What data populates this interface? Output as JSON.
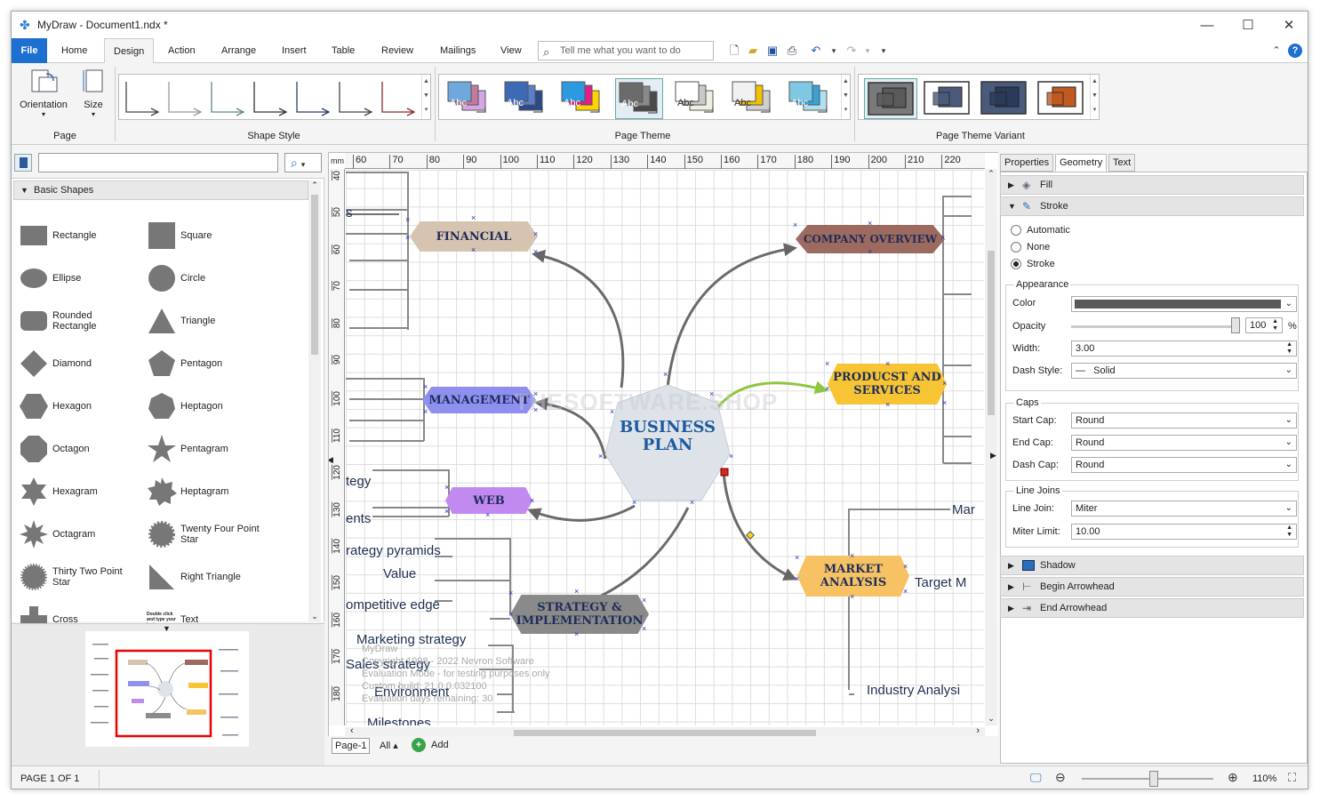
{
  "window": {
    "title": "MyDraw - Document1.ndx *"
  },
  "tabs": [
    "File",
    "Home",
    "Design",
    "Action",
    "Arrange",
    "Insert",
    "Table",
    "Review",
    "Mailings",
    "View"
  ],
  "active_tab": "Design",
  "tellme": {
    "placeholder": "Tell me what you want to do"
  },
  "ribbon": {
    "page_group": {
      "orientation": "Orientation",
      "size": "Size",
      "label": "Page"
    },
    "shape_style_label": "Shape Style",
    "page_theme_label": "Page Theme",
    "page_theme_variant_label": "Page Theme Variant",
    "theme_text": "Abc",
    "themes": [
      {
        "a": "#6fa8dc",
        "b": "#c27ba0",
        "c": "#d5a6e6"
      },
      {
        "a": "#3d6bb3",
        "b": "#5a7ec9",
        "c": "#2b4a8a"
      },
      {
        "a": "#2b9ae0",
        "b": "#e0208a",
        "c": "#ffd200"
      },
      {
        "a": "#6b6b6b",
        "b": "#8a8a8a",
        "c": "#4a4a4a"
      },
      {
        "a": "#ffffff",
        "b": "#c9c9c9",
        "c": "#f0f0e0"
      },
      {
        "a": "#f0f0f0",
        "b": "#f2c200",
        "c": "#d0d0d0"
      },
      {
        "a": "#7ec8e3",
        "b": "#3aa0d8",
        "c": "#b0e0f0"
      }
    ],
    "variants": [
      {
        "a": "#7a7a7a",
        "b": "#5a5a5a"
      },
      {
        "a": "#ffffff",
        "b": "#4a5a7a"
      },
      {
        "a": "#4a5a7a",
        "b": "#2a3a5a"
      },
      {
        "a": "#ffffff",
        "b": "#c05a20"
      }
    ]
  },
  "shapes_panel": {
    "category": "Basic Shapes",
    "items": [
      "Rectangle",
      "Square",
      "Ellipse",
      "Circle",
      "Rounded Rectangle",
      "Triangle",
      "Diamond",
      "Pentagon",
      "Hexagon",
      "Heptagon",
      "Octagon",
      "Pentagram",
      "Hexagram",
      "Heptagram",
      "Octagram",
      "Twenty Four Point Star",
      "Thirty Two Point Star",
      "Right Triangle",
      "Cross",
      "Text"
    ],
    "text_hint": "Double click and type your text"
  },
  "ruler": {
    "unit": "mm",
    "top": [
      "60",
      "70",
      "80",
      "90",
      "100",
      "110",
      "120",
      "130",
      "140",
      "150",
      "160",
      "170",
      "180",
      "190",
      "200",
      "210",
      "220"
    ],
    "left": [
      "40",
      "50",
      "60",
      "70",
      "80",
      "90",
      "100",
      "110",
      "120",
      "130",
      "140",
      "150",
      "160",
      "170",
      "180"
    ]
  },
  "diagram": {
    "center": "BUSINESS PLAN",
    "nodes": {
      "financial": "FINANCIAL",
      "management": "MANAGEMENT",
      "web": "WEB",
      "strategy": "STRATEGY & IMPLEMENTATION",
      "company": "COMPANY OVERVIEW",
      "products": "PRODUCST AND SERVICES",
      "market": "MARKET ANALYSIS"
    },
    "colors": {
      "financial": "#d6c4b0",
      "management": "#8f8ff0",
      "web": "#c08af0",
      "strategy": "#8a8a8a",
      "company": "#9c6a5e",
      "products": "#f7c533",
      "market": "#f7c264",
      "center": "#dde3e8"
    },
    "labels": [
      "s",
      "tegy",
      "ents",
      "rategy pyramids",
      "Value",
      "ompetitive edge",
      "Marketing strategy",
      "Sales strategy",
      "Environment",
      "Milestones",
      "Mar",
      "Target M",
      "Industry Analysi"
    ],
    "watermark": [
      "MyDraw",
      "Copyright 1998 - 2022 Nevron Software",
      "Evaluation Mode - for testing purposes only",
      "Custom build: 21.0.0.032100",
      "Evaluation days remaining: 30"
    ],
    "stamp": "THESOFTWARE.SHOP"
  },
  "page_tabs": {
    "current": "Page-1",
    "all": "All",
    "add": "Add"
  },
  "properties": {
    "tabs": [
      "Properties",
      "Geometry",
      "Text"
    ],
    "active_tab": "Geometry",
    "fill": "Fill",
    "stroke": "Stroke",
    "stroke_mode": [
      "Automatic",
      "None",
      "Stroke"
    ],
    "selected_mode": "Stroke",
    "appearance": {
      "label": "Appearance",
      "color_label": "Color",
      "color": "#595959",
      "opacity_label": "Opacity",
      "opacity": "100",
      "opacity_unit": "%",
      "width_label": "Width:",
      "width": "3.00",
      "dash_label": "Dash Style:",
      "dash": "Solid"
    },
    "caps": {
      "label": "Caps",
      "start_label": "Start Cap:",
      "start": "Round",
      "end_label": "End Cap:",
      "end": "Round",
      "dash_label": "Dash Cap:",
      "dash": "Round"
    },
    "joins": {
      "label": "Line Joins",
      "join_label": "Line Join:",
      "join": "Miter",
      "miter_label": "Miter Limit:",
      "miter": "10.00"
    },
    "shadow": "Shadow",
    "begin_arrow": "Begin Arrowhead",
    "end_arrow": "End Arrowhead"
  },
  "status": {
    "page": "PAGE 1 OF 1",
    "zoom": "110%",
    "zoom_level": 0.55
  }
}
